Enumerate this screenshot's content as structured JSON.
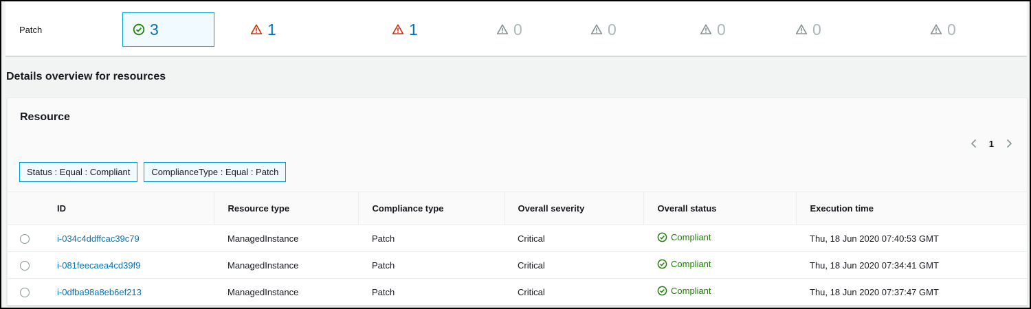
{
  "summary": {
    "row_label": "Patch",
    "metrics": [
      {
        "value": "3",
        "icon": "check-circle-icon",
        "color": "#0073bb",
        "selected": true
      },
      {
        "value": "1",
        "icon": "warning-icon",
        "color": "#0073bb"
      },
      {
        "value": "1",
        "icon": "warning-icon",
        "color": "#0073bb"
      },
      {
        "value": "0",
        "icon": "warning-icon",
        "color": "#aab7b8"
      },
      {
        "value": "0",
        "icon": "warning-icon",
        "color": "#aab7b8"
      },
      {
        "value": "0",
        "icon": "warning-icon",
        "color": "#aab7b8"
      },
      {
        "value": "0",
        "icon": "warning-icon",
        "color": "#aab7b8"
      },
      {
        "value": "0",
        "icon": "warning-icon",
        "color": "#aab7b8"
      }
    ]
  },
  "details_title": "Details overview for resources",
  "resource": {
    "title": "Resource",
    "page": "1",
    "filters": [
      "Status : Equal : Compliant",
      "ComplianceType : Equal : Patch"
    ],
    "columns": [
      "ID",
      "Resource type",
      "Compliance type",
      "Overall severity",
      "Overall status",
      "Execution time"
    ],
    "rows": [
      {
        "id": "i-034c4ddffcac39c79",
        "resource_type": "ManagedInstance",
        "compliance_type": "Patch",
        "severity": "Critical",
        "status": "Compliant",
        "time": "Thu, 18 Jun 2020 07:40:53 GMT"
      },
      {
        "id": "i-081feecaea4cd39f9",
        "resource_type": "ManagedInstance",
        "compliance_type": "Patch",
        "severity": "Critical",
        "status": "Compliant",
        "time": "Thu, 18 Jun 2020 07:34:41 GMT"
      },
      {
        "id": "i-0dfba98a8eb6ef213",
        "resource_type": "ManagedInstance",
        "compliance_type": "Patch",
        "severity": "Critical",
        "status": "Compliant",
        "time": "Thu, 18 Jun 2020 07:37:47 GMT"
      }
    ]
  },
  "colors": {
    "link": "#0073bb",
    "success": "#1d8102",
    "error": "#d13212",
    "muted": "#aab7b8",
    "selected_border": "#00a1c9"
  }
}
